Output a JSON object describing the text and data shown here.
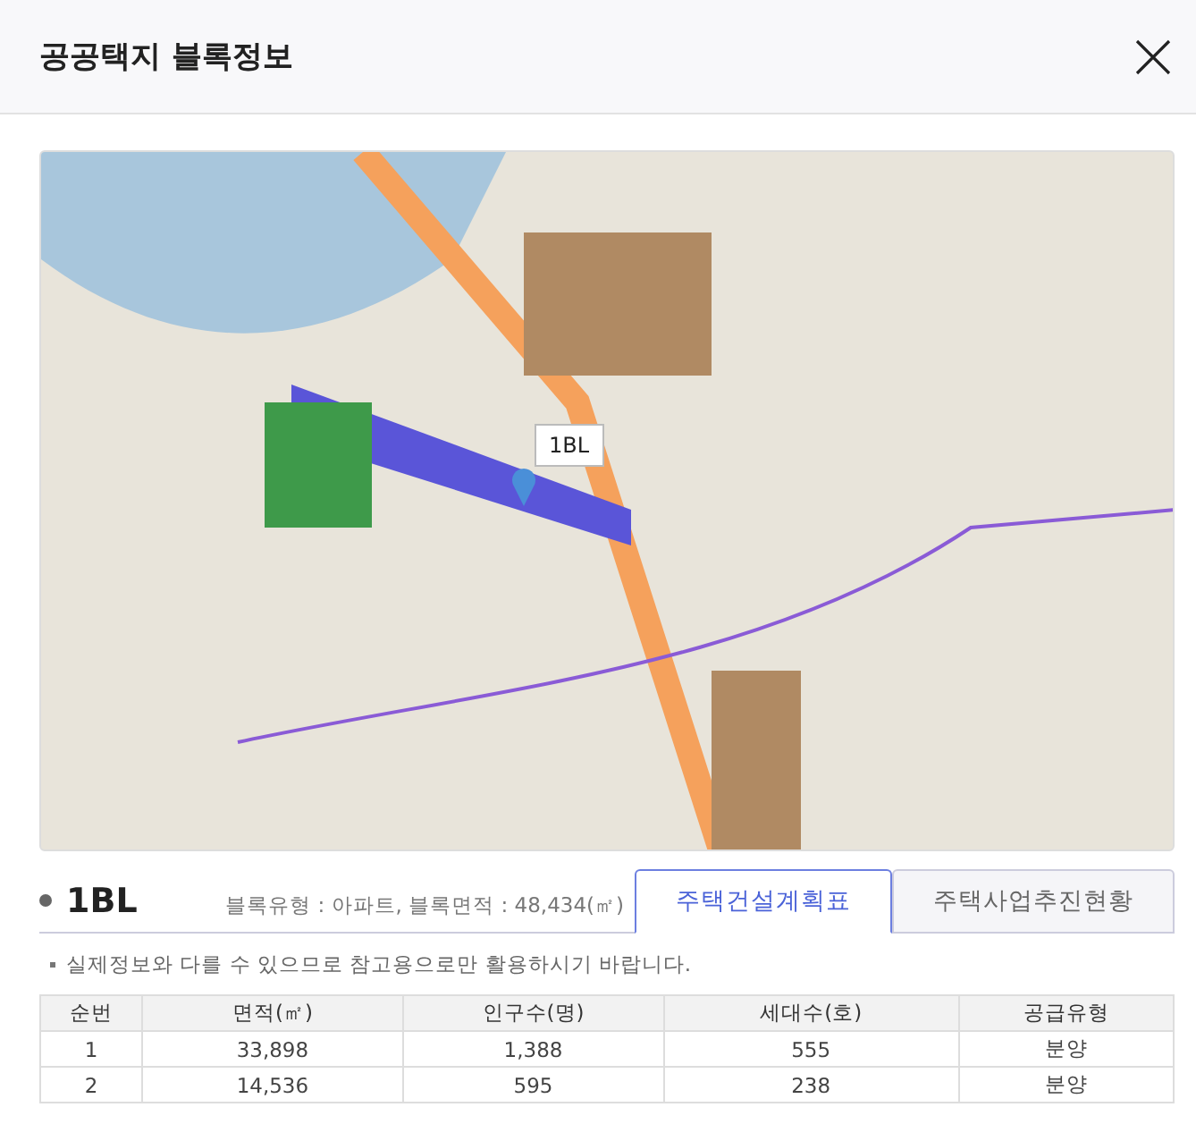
{
  "window": {
    "title": "공공택지 블록정보"
  },
  "map": {
    "marker_label": "1BL"
  },
  "block": {
    "name": "1BL",
    "summary": "블록유형 : 아파트, 블록면적 : 48,434(㎡)"
  },
  "tabs": [
    {
      "label": "주택건설계획표",
      "selected": true
    },
    {
      "label": "주택사업추진현황",
      "selected": false
    }
  ],
  "notice": "실제정보와 다를 수 있으므로 참고용으로만 활용하시기 바랍니다.",
  "table": {
    "columns": [
      "순번",
      "면적(㎡)",
      "인구수(명)",
      "세대수(호)",
      "공급유형"
    ],
    "rows": [
      [
        "1",
        "33,898",
        "1,388",
        "555",
        "분양"
      ],
      [
        "2",
        "14,536",
        "595",
        "238",
        "분양"
      ]
    ]
  }
}
